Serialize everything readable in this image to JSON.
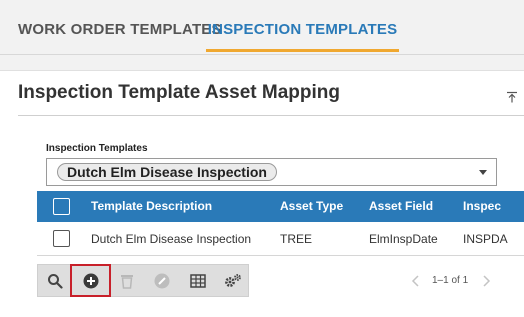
{
  "tabs": [
    {
      "label": "WORK ORDER TEMPLATES",
      "active": false
    },
    {
      "label": "INSPECTION TEMPLATES",
      "active": true
    }
  ],
  "panel": {
    "title": "Inspection Template Asset Mapping",
    "field_label": "Inspection Templates",
    "selected_template": "Dutch Elm Disease Inspection"
  },
  "grid": {
    "columns": [
      "Template Description",
      "Asset Type",
      "Asset Field",
      "Inspec"
    ],
    "rows": [
      {
        "description": "Dutch Elm Disease Inspection",
        "asset_type": "TREE",
        "asset_field": "ElmInspDate",
        "inspection": "INSPDA"
      }
    ]
  },
  "toolbar": {
    "icons": [
      "search-icon",
      "add-icon",
      "delete-icon",
      "edit-icon",
      "grid-icon",
      "settings-icon"
    ]
  },
  "pager": {
    "text": "1–1 of 1"
  },
  "colors": {
    "accent": "#2a7ab8",
    "tab_underline": "#f0a830",
    "highlight": "#c8202a"
  }
}
